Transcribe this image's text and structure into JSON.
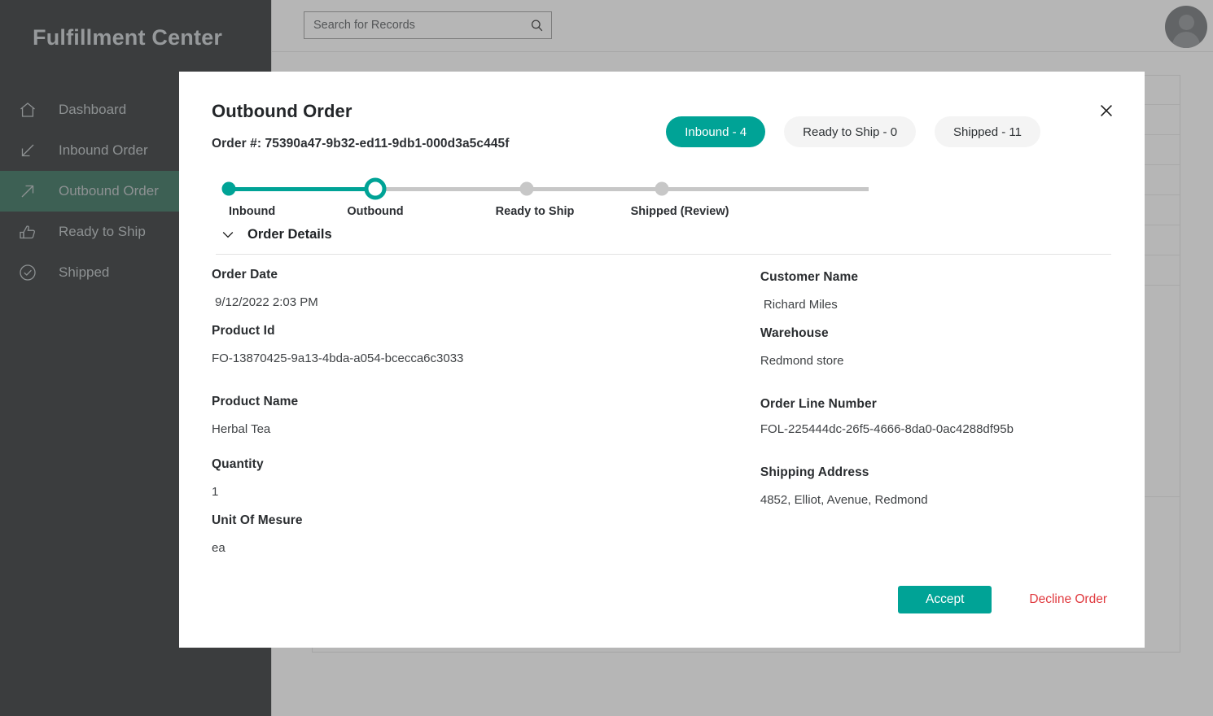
{
  "sidebar": {
    "brand": "Fulfillment Center",
    "items": [
      {
        "label": "Dashboard",
        "icon": "home-icon",
        "active": false
      },
      {
        "label": "Inbound Order",
        "icon": "arrow-down-left-icon",
        "active": false
      },
      {
        "label": "Outbound Order",
        "icon": "arrow-up-right-icon",
        "active": true
      },
      {
        "label": "Ready to Ship",
        "icon": "thumbs-up-icon",
        "active": false
      },
      {
        "label": "Shipped",
        "icon": "check-circle-icon",
        "active": false
      }
    ]
  },
  "topbar": {
    "search_placeholder": "Search for Records",
    "search_value": "",
    "search_icon": "search-icon",
    "avatar_icon": "user-avatar-icon"
  },
  "modal": {
    "title": "Outbound Order",
    "order_number_label": "Order #: 75390a47-9b32-ed11-9db1-000d3a5c445f",
    "close_icon": "close-icon",
    "tabs": [
      {
        "label": "Inbound - 4",
        "active": true
      },
      {
        "label": "Ready to Ship - 0",
        "active": false
      },
      {
        "label": "Shipped - 11",
        "active": false
      }
    ],
    "stepper": {
      "steps": [
        {
          "label": "Inbound",
          "state": "done"
        },
        {
          "label": "Outbound",
          "state": "current"
        },
        {
          "label": "Ready to Ship",
          "state": "pending"
        },
        {
          "label": "Shipped (Review)",
          "state": "pending"
        }
      ]
    },
    "section": {
      "title": "Order Details",
      "chevron_icon": "chevron-down-icon"
    },
    "fields_left": [
      {
        "label": "Order Date",
        "value": "9/12/2022 2:03 PM"
      },
      {
        "label": "Product Id",
        "value": "FO-13870425-9a13-4bda-a054-bcecca6c3033"
      },
      {
        "label": "Product Name",
        "value": "Herbal Tea"
      },
      {
        "label": "Quantity",
        "value": "1"
      },
      {
        "label": "Unit Of Mesure",
        "value": "ea"
      }
    ],
    "fields_right": [
      {
        "label": "Customer Name",
        "value": "Richard Miles"
      },
      {
        "label": "Warehouse",
        "value": "Redmond store"
      },
      {
        "label": "Order Line Number",
        "value": "FOL-225444dc-26f5-4666-8da0-0ac4288df95b"
      },
      {
        "label": "Shipping Address",
        "value": "4852, Elliot, Avenue, Redmond"
      }
    ],
    "actions": {
      "accept_label": "Accept",
      "decline_label": "Decline Order"
    }
  },
  "colors": {
    "accent_teal": "#00a396",
    "sidebar_bg": "#2b2f31",
    "sidebar_active": "#2f6b56",
    "danger_red": "#e0393e"
  }
}
